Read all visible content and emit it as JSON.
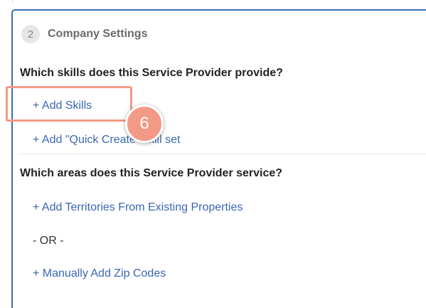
{
  "step": {
    "number": "2",
    "title": "Company Settings"
  },
  "skills_section": {
    "question": "Which skills does this Service Provider provide?",
    "add_skills_label": "+ Add Skills",
    "add_quick_create_label": "+ Add \"Quick Create\" skill set"
  },
  "areas_section": {
    "question": "Which areas does this Service Provider service?",
    "add_territories_label": "+ Add Territories From Existing Properties",
    "or_label": "- OR -",
    "add_zip_codes_label": "+ Manually Add Zip Codes"
  },
  "annotation": {
    "callout_number": "6",
    "highlight_color": "#f29a86"
  },
  "colors": {
    "accent_border": "#3f6db8",
    "link": "#3a67b3"
  }
}
